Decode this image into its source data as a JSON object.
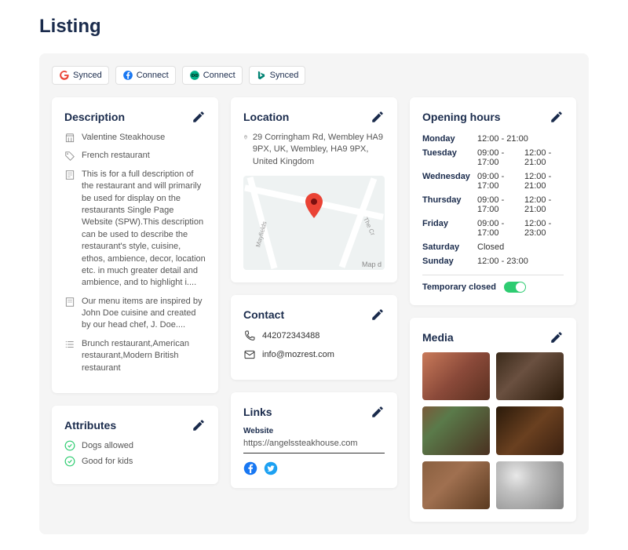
{
  "page_title": "Listing",
  "sync": [
    {
      "provider": "google",
      "label": "Synced",
      "color": "#4285F4"
    },
    {
      "provider": "facebook",
      "label": "Connect",
      "color": "#1877F2"
    },
    {
      "provider": "tripadvisor",
      "label": "Connect",
      "color": "#00AF87"
    },
    {
      "provider": "bing",
      "label": "Synced",
      "color": "#008373"
    }
  ],
  "description": {
    "title": "Description",
    "name": "Valentine Steakhouse",
    "cuisine": "French restaurant",
    "long_desc": "This is for a full description of the restaurant and will primarily be used for display on the restaurants Single Page Website (SPW).This description can be used to describe the restaurant's style, cuisine, ethos, ambience, decor, location etc. in much greater detail and ambience, and to highlight i....",
    "menu_desc": "Our menu items are inspired by John Doe cuisine and created by our head chef, J. Doe....",
    "tags": "Brunch restaurant,American restaurant,Modern British restaurant"
  },
  "attributes": {
    "title": "Attributes",
    "items": [
      "Dogs allowed",
      "Good for kids"
    ]
  },
  "location": {
    "title": "Location",
    "address": "29 Corringham Rd, Wembley HA9 9PX, UK, Wembley, HA9 9PX, United Kingdom",
    "map_attr": "Map d",
    "street1": "Mayfields",
    "street2": "The Cr"
  },
  "contact": {
    "title": "Contact",
    "phone": "442072343488",
    "email": "info@mozrest.com"
  },
  "links": {
    "title": "Links",
    "label": "Website",
    "url": "https://angelssteakhouse.com"
  },
  "hours": {
    "title": "Opening hours",
    "days": [
      {
        "day": "Monday",
        "t1": "12:00 - 21:00",
        "t2": ""
      },
      {
        "day": "Tuesday",
        "t1": "09:00 - 17:00",
        "t2": "12:00 - 21:00"
      },
      {
        "day": "Wednesday",
        "t1": "09:00 - 17:00",
        "t2": "12:00 - 21:00"
      },
      {
        "day": "Thursday",
        "t1": "09:00 - 17:00",
        "t2": "12:00 - 21:00"
      },
      {
        "day": "Friday",
        "t1": "09:00 - 17:00",
        "t2": "12:00 - 23:00"
      },
      {
        "day": "Saturday",
        "t1": "Closed",
        "t2": ""
      },
      {
        "day": "Sunday",
        "t1": "12:00 - 23:00",
        "t2": ""
      }
    ],
    "temp_closed_label": "Temporary closed"
  },
  "media": {
    "title": "Media"
  }
}
